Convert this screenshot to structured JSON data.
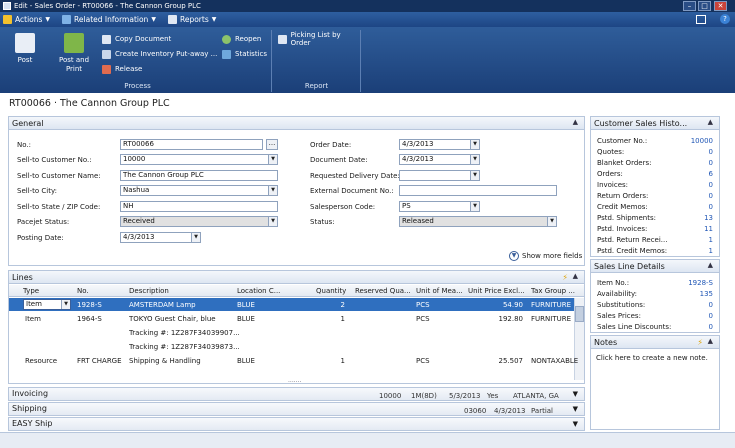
{
  "window": {
    "title": "Edit - Sales Order - RT00066 - The Cannon Group PLC"
  },
  "menu": [
    {
      "label": "Actions",
      "icon": "lightning-icon",
      "color": "#f2c12e"
    },
    {
      "label": "Related Information",
      "icon": "related-info-icon",
      "color": "#7fb2e6"
    },
    {
      "label": "Reports",
      "icon": "reports-icon",
      "color": "#dfe7f3"
    }
  ],
  "ribbon": {
    "process_label": "Process",
    "report_label": "Report",
    "post": "Post",
    "post_and_print": "Post and Print",
    "copy_document": "Copy Document",
    "create_inventory": "Create Inventory Put-away ...",
    "release": "Release",
    "reopen": "Reopen",
    "statistics": "Statistics",
    "picking_list": "Picking List by Order"
  },
  "page_title": "RT00066 · The Cannon Group PLC",
  "general": {
    "header": "General",
    "no_label": "No.:",
    "no_value": "RT00066",
    "customer_no_label": "Sell-to Customer No.:",
    "customer_no_value": "10000",
    "customer_name_label": "Sell-to Customer Name:",
    "customer_name_value": "The Cannon Group PLC",
    "city_label": "Sell-to City:",
    "city_value": "Nashua",
    "state_label": "Sell-to State / ZIP Code:",
    "state_value": "NH",
    "pacejet_label": "Pacejet Status:",
    "pacejet_value": "Received",
    "posting_date_label": "Posting Date:",
    "posting_date_value": "4/3/2013",
    "order_date_label": "Order Date:",
    "order_date_value": "4/3/2013",
    "document_date_label": "Document Date:",
    "document_date_value": "4/3/2013",
    "requested_delivery_label": "Requested Delivery Date:",
    "requested_delivery_value": "",
    "external_doc_label": "External Document No.:",
    "external_doc_value": "",
    "salesperson_label": "Salesperson Code:",
    "salesperson_value": "PS",
    "status_label": "Status:",
    "status_value": "Released",
    "show_more": "Show more fields"
  },
  "lines": {
    "header": "Lines",
    "columns": [
      "Type",
      "No.",
      "Description",
      "Location C...",
      "Quantity",
      "Reserved Qua...",
      "Unit of Mea...",
      "Unit Price Excl...",
      "Tax Group ..."
    ],
    "rows": [
      {
        "type": "Item",
        "no": "1928-S",
        "description": "AMSTERDAM Lamp",
        "location": "BLUE",
        "quantity": "2",
        "reserved": "",
        "uom": "PCS",
        "price": "54.90",
        "tax": "FURNITURE"
      },
      {
        "type": "Item",
        "no": "1964-S",
        "description": "TOKYO Guest Chair, blue",
        "location": "BLUE",
        "quantity": "1",
        "reserved": "",
        "uom": "PCS",
        "price": "192.80",
        "tax": "FURNITURE"
      },
      {
        "type": "",
        "no": "",
        "description": "Tracking #: 1Z287F34039907...",
        "location": "",
        "quantity": "",
        "reserved": "",
        "uom": "",
        "price": "",
        "tax": ""
      },
      {
        "type": "",
        "no": "",
        "description": "Tracking #: 1Z287F34039873...",
        "location": "",
        "quantity": "",
        "reserved": "",
        "uom": "",
        "price": "",
        "tax": ""
      },
      {
        "type": "Resource",
        "no": "FRT CHARGE",
        "description": "Shipping & Handling",
        "location": "BLUE",
        "quantity": "1",
        "reserved": "",
        "uom": "PCS",
        "price": "25.507",
        "tax": "NONTAXABLE"
      }
    ]
  },
  "fasttabs": {
    "invoicing": {
      "label": "Invoicing",
      "s1": "10000",
      "s2": "1M(8D)",
      "s3": "5/3/2013",
      "s4": "Yes",
      "s5": "ATLANTA, GA"
    },
    "shipping": {
      "label": "Shipping",
      "s1": "03060",
      "s2": "4/3/2013",
      "s3": "Partial"
    },
    "easyship": {
      "label": "EASY Ship"
    }
  },
  "factbox_sales_history": {
    "header": "Customer Sales Histo...",
    "rows": [
      {
        "label": "Customer No.:",
        "value": "10000"
      },
      {
        "label": "Quotes:",
        "value": "0"
      },
      {
        "label": "Blanket Orders:",
        "value": "0"
      },
      {
        "label": "Orders:",
        "value": "6"
      },
      {
        "label": "Invoices:",
        "value": "0"
      },
      {
        "label": "Return Orders:",
        "value": "0"
      },
      {
        "label": "Credit Memos:",
        "value": "0"
      },
      {
        "label": "Pstd. Shipments:",
        "value": "13"
      },
      {
        "label": "Pstd. Invoices:",
        "value": "11"
      },
      {
        "label": "Pstd. Return Recei...",
        "value": "1"
      },
      {
        "label": "Pstd. Credit Memos:",
        "value": "1"
      }
    ]
  },
  "factbox_line_details": {
    "header": "Sales Line Details",
    "rows": [
      {
        "label": "Item No.:",
        "value": "1928-S"
      },
      {
        "label": "Availability:",
        "value": "135"
      },
      {
        "label": "Substitutions:",
        "value": "0"
      },
      {
        "label": "Sales Prices:",
        "value": "0"
      },
      {
        "label": "Sales Line Discounts:",
        "value": "0"
      }
    ]
  },
  "factbox_notes": {
    "header": "Notes",
    "placeholder": "Click here to create a new note."
  }
}
